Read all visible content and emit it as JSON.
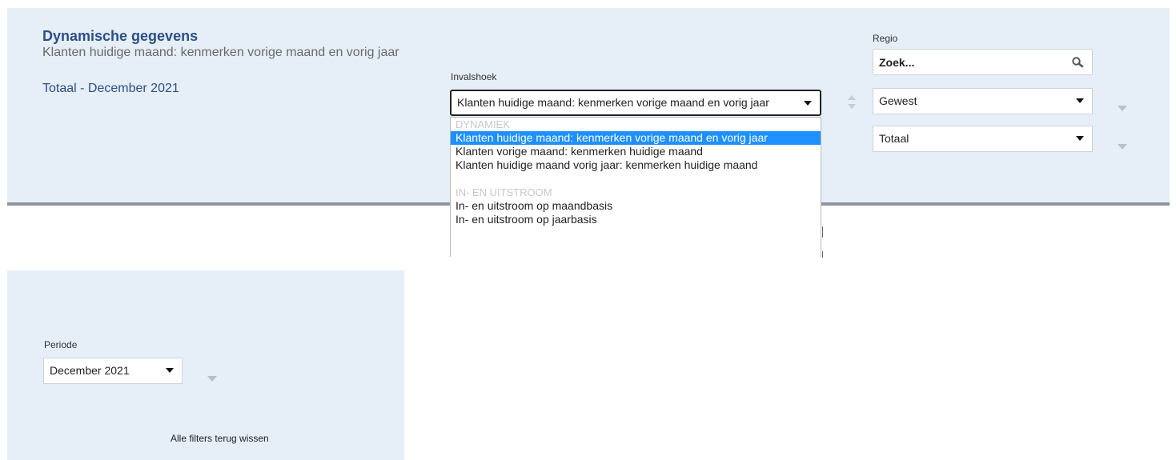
{
  "header": {
    "title": "Dynamische gegevens",
    "subtitle": "Klanten huidige maand: kenmerken vorige maand en vorig jaar",
    "period_line": "Totaal - December 2021"
  },
  "invalshoek": {
    "label": "Invalshoek",
    "selected": "Klanten huidige maand: kenmerken vorige maand en vorig jaar",
    "groups": [
      {
        "name": "DYNAMIEK",
        "options": [
          "Klanten huidige maand: kenmerken vorige maand en vorig jaar",
          "Klanten vorige maand: kenmerken huidige maand",
          "Klanten huidige maand vorig jaar: kenmerken huidige maand"
        ]
      },
      {
        "name": "IN- EN UITSTROOM",
        "options": [
          "In- en uitstroom op maandbasis",
          "In- en uitstroom op jaarbasis"
        ]
      }
    ]
  },
  "regio": {
    "label": "Regio",
    "search_placeholder": "Zoek...",
    "level_value": "Gewest",
    "area_value": "Totaal"
  },
  "periode": {
    "label": "Periode",
    "value": "December 2021"
  },
  "filters": {
    "clear_label": "Alle filters terug wissen"
  },
  "colors": {
    "panel_bg": "#e6eef8",
    "title_blue": "#2c4f86",
    "selected_option": "#1e90ff"
  }
}
